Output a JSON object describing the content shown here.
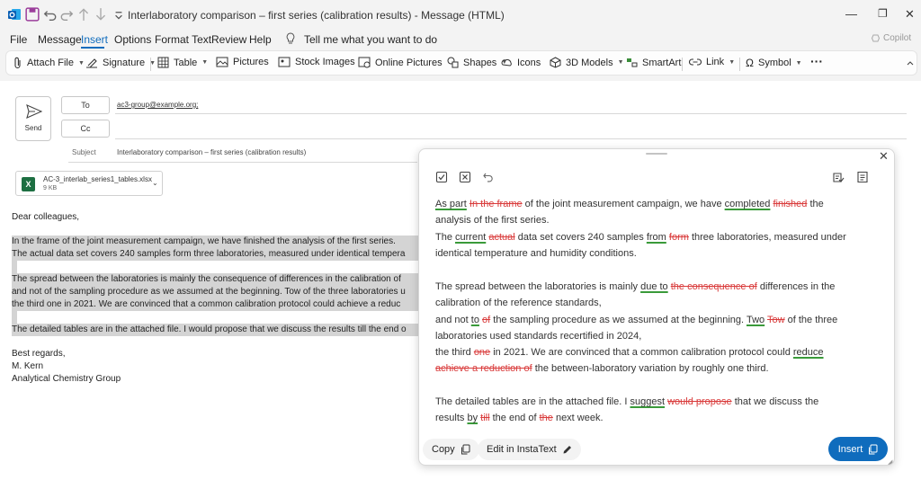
{
  "window": {
    "title": "Interlaboratory comparison – first series (calibration results)  -  Message (HTML)",
    "controls": {
      "minimize": "—",
      "restore": "❐",
      "close": "✕"
    }
  },
  "menu": {
    "items": [
      "File",
      "Message",
      "Insert",
      "Options",
      "Format Text",
      "Review",
      "Help"
    ],
    "active": "Insert",
    "tell_me": "Tell me what you want to do",
    "copilot": "Copilot"
  },
  "ribbon": {
    "attach_file": "Attach File",
    "signature": "Signature",
    "table": "Table",
    "pictures": "Pictures",
    "stock_images": "Stock Images",
    "online_pictures": "Online Pictures",
    "shapes": "Shapes",
    "icons": "Icons",
    "models_3d": "3D Models",
    "smartart": "SmartArt",
    "link": "Link",
    "symbol": "Symbol",
    "more": "···"
  },
  "compose": {
    "send_label": "Send",
    "to_label": "To",
    "cc_label": "Cc",
    "to_value": "ac3-group@example.org;",
    "subject_label": "Subject",
    "subject_value": "Interlaboratory comparison – first series (calibration results)",
    "attachment": {
      "name": "AC-3_interlab_series1_tables.xlsx",
      "size": "9 KB",
      "icon": "excel-icon"
    }
  },
  "body": {
    "greeting": "Dear colleagues,",
    "lines": [
      "In the frame of the joint measurement campaign, we have finished the analysis of the first series.",
      "The actual data set covers 240 samples form three laboratories, measured under identical tempera",
      "The spread between the laboratories is mainly the consequence of differences in the calibration of",
      "and not of the sampling procedure as we assumed at the beginning. Tow of the three laboratories u",
      "the third one in 2021. We are convinced that a common calibration protocol could achieve a reduc",
      "The detailed tables are in the attached file. I would propose that we discuss the results till the end o"
    ],
    "closing": "Best regards,",
    "name": "M. Kern",
    "group": "Analytical Chemistry Group"
  },
  "instatext": {
    "copy_label": "Copy",
    "edit_label": "Edit in InstaText",
    "insert_label": "Insert",
    "p1": {
      "add1": "As part",
      "del1": "In the frame",
      "t1": " of the joint measurement campaign, we have ",
      "add2": "completed",
      "del2": "finished",
      "t2": " the",
      "l2": "analysis of the first series.",
      "t3": "The ",
      "add3": "current",
      "del3": "actual",
      "t4": " data set covers 240 samples ",
      "add4": "from",
      "del4": "form",
      "t5": " three laboratories, measured under",
      "l5": "identical temperature and humidity conditions."
    },
    "p2": {
      "t1": "The spread between the laboratories is mainly ",
      "add1": "due to",
      "del1": "the consequence of",
      "t2": " differences in the",
      "l2": "calibration of the reference standards,",
      "t3": "and not ",
      "add2": "to",
      "del2": "of",
      "t4": " the sampling procedure as we assumed at the beginning. ",
      "add3": "Two",
      "del3": "Tow",
      "t5": " of the three",
      "l5": "laboratories used standards recertified in 2024,",
      "t6": "the third ",
      "del4": "one",
      "t7": " in 2021. We are convinced that a common calibration protocol could ",
      "add4": "reduce",
      "del5": "achieve a reduction of",
      "t8": " the between-laboratory variation by roughly one third."
    },
    "p3": {
      "t1": "The detailed tables are in the attached file. I ",
      "add1": "suggest",
      "del1": "would propose",
      "t2": " that we discuss the",
      "t3": "results ",
      "add2": "by",
      "del2": "till",
      "t4": " the end of ",
      "del3": "the",
      "t5": " next week."
    }
  }
}
